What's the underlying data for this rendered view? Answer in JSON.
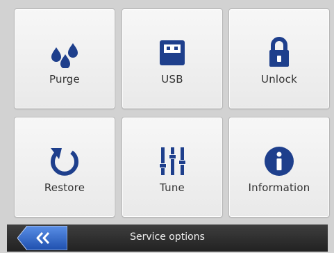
{
  "tiles": [
    {
      "label": "Purge",
      "icon": "water-drops-icon"
    },
    {
      "label": "USB",
      "icon": "usb-icon"
    },
    {
      "label": "Unlock",
      "icon": "lock-icon"
    },
    {
      "label": "Restore",
      "icon": "restore-icon"
    },
    {
      "label": "Tune",
      "icon": "sliders-icon"
    },
    {
      "label": "Information",
      "icon": "info-icon"
    }
  ],
  "bottom_bar": {
    "title": "Service options",
    "back_icon": "double-chevron-left-icon"
  },
  "colors": {
    "icon": "#1e3f8c",
    "background": "#d2d2d2",
    "tile": "#efefef",
    "bar": "#2e2e2e",
    "back_button": "#2d66c9"
  }
}
